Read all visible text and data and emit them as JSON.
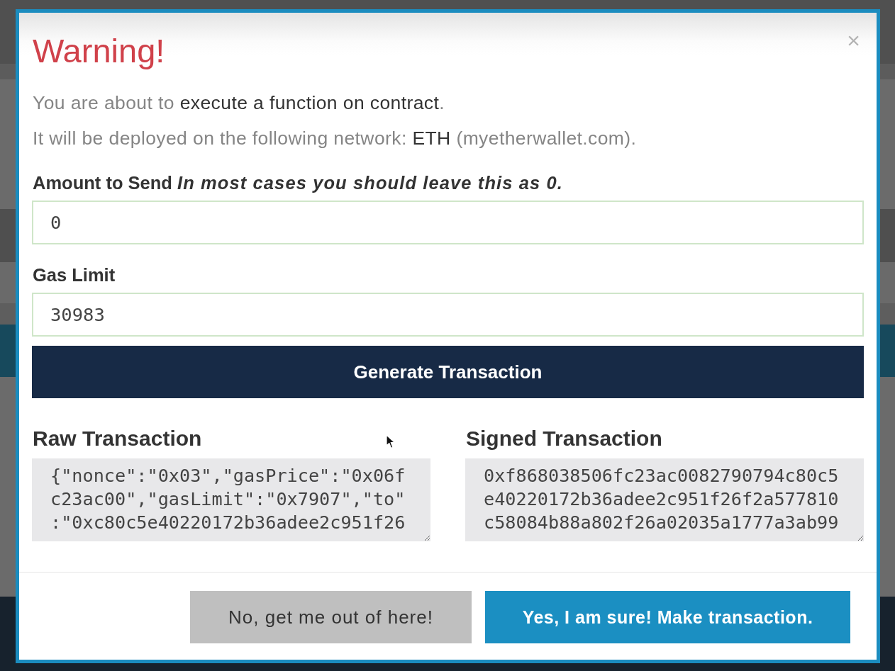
{
  "dialog": {
    "title": "Warning!",
    "close_label": "×",
    "messages": [
      "You are about to **execute a function on contract**.",
      "It will be deployed on the following network: **ETH** (myetherwallet.com)."
    ],
    "fields": [
      {
        "label": "Amount to Send *In most cases you should leave this as 0.*",
        "value": "0"
      },
      {
        "label": "Gas Limit",
        "value": "30983"
      }
    ],
    "generate_button": "Generate Transaction",
    "outputs": [
      {
        "label": "Raw Transaction",
        "lines": [
          "{\"nonce\":\"0x03\",\"gasPrice\":\"0x06f",
          "c23ac00\",\"gasLimit\":\"0x7907\",\"to\"",
          ":\"0xc80c5e40220172b36adee2c951f26"
        ]
      },
      {
        "label": "Signed Transaction",
        "lines": [
          "0xf868038506fc23ac0082790794c80c5",
          "e40220172b36adee2c951f26f2a577810",
          "c58084b88a802f26a02035a1777a3ab99"
        ]
      }
    ],
    "buttons": [
      {
        "label": "No, get me out of here!",
        "kind": "secondary"
      },
      {
        "label": "Yes, I am sure! Make transaction.",
        "kind": "primary"
      }
    ]
  }
}
